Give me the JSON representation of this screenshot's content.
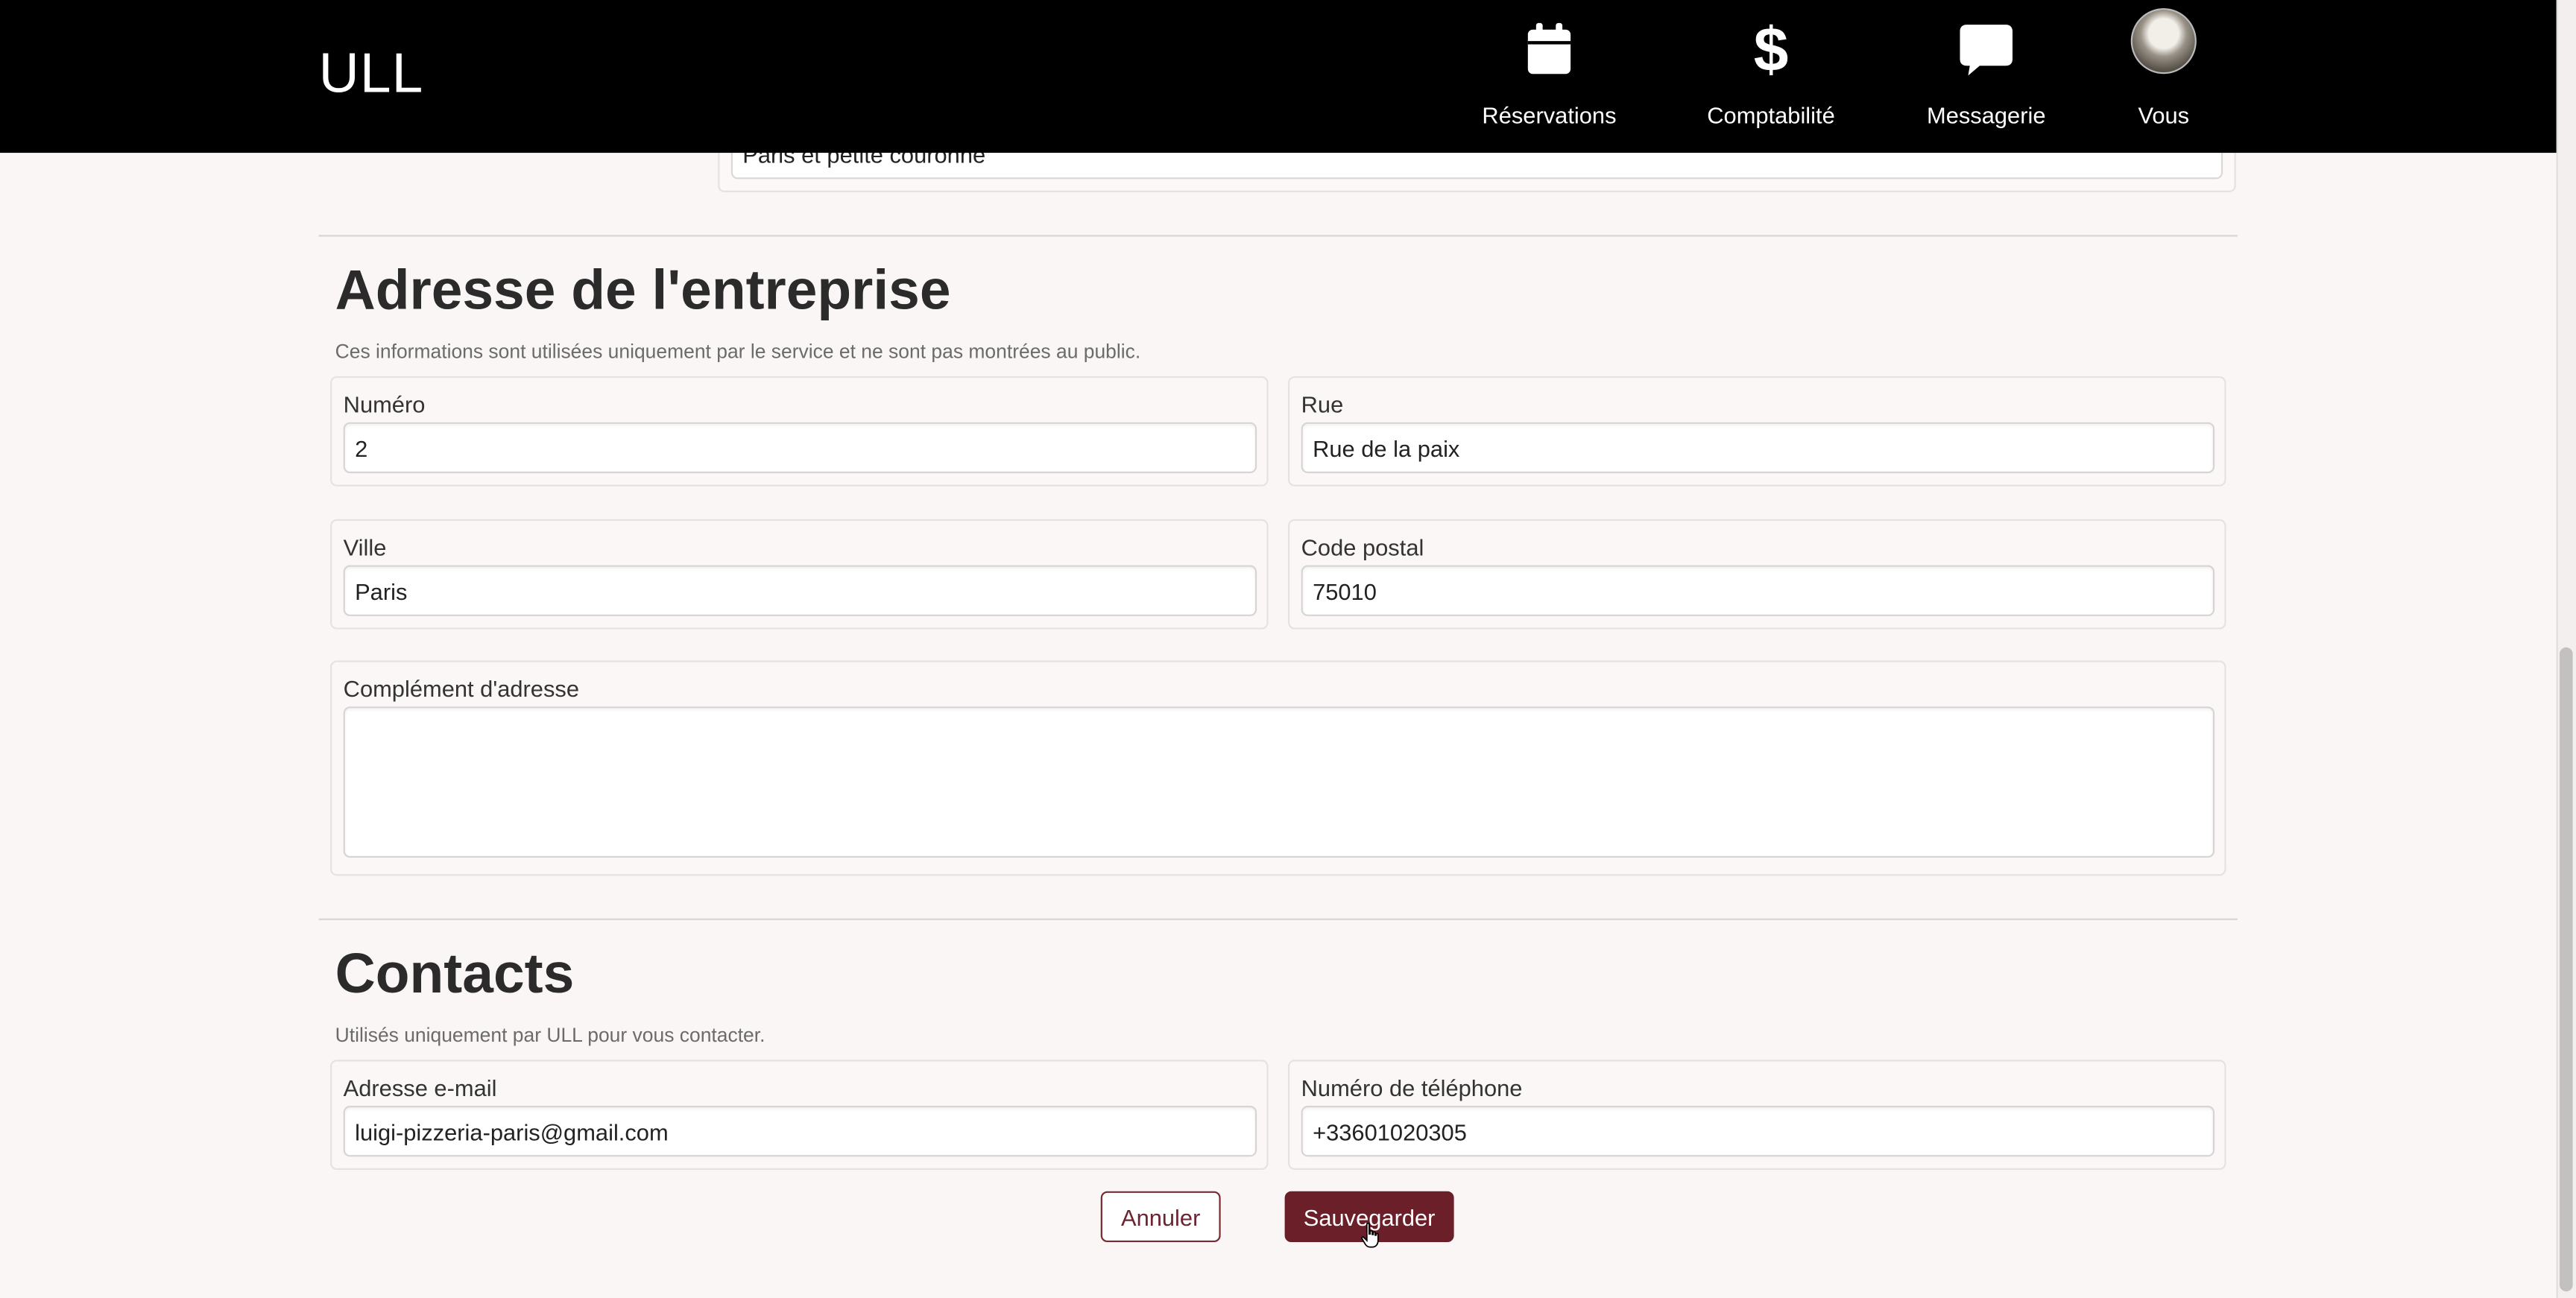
{
  "header": {
    "brand": "ULL",
    "nav": [
      {
        "label": "Réservations",
        "icon": "calendar-icon"
      },
      {
        "label": "Comptabilité",
        "icon": "dollar-icon"
      },
      {
        "label": "Messagerie",
        "icon": "chat-bubble-icon"
      },
      {
        "label": "Vous",
        "icon": "avatar"
      }
    ]
  },
  "previous_section": {
    "zone_value": "Paris et petite couronne"
  },
  "address_section": {
    "title": "Adresse de l'entreprise",
    "description": "Ces informations sont utilisées uniquement par le service et ne sont pas montrées au public.",
    "numero": {
      "label": "Numéro",
      "value": "2"
    },
    "rue": {
      "label": "Rue",
      "value": "Rue de la paix"
    },
    "ville": {
      "label": "Ville",
      "value": "Paris"
    },
    "code_postal": {
      "label": "Code postal",
      "value": "75010"
    },
    "complement": {
      "label": "Complément d'adresse",
      "value": ""
    }
  },
  "contacts_section": {
    "title": "Contacts",
    "description": "Utilisés uniquement par ULL pour vous contacter.",
    "email": {
      "label": "Adresse e-mail",
      "value": "luigi-pizzeria-paris@gmail.com"
    },
    "phone": {
      "label": "Numéro de téléphone",
      "value": "+33601020305"
    }
  },
  "actions": {
    "cancel_label": "Annuler",
    "save_label": "Sauvegarder"
  },
  "colors": {
    "header_bg": "#000000",
    "page_bg": "#faf6f5",
    "accent": "#6b1f29"
  }
}
